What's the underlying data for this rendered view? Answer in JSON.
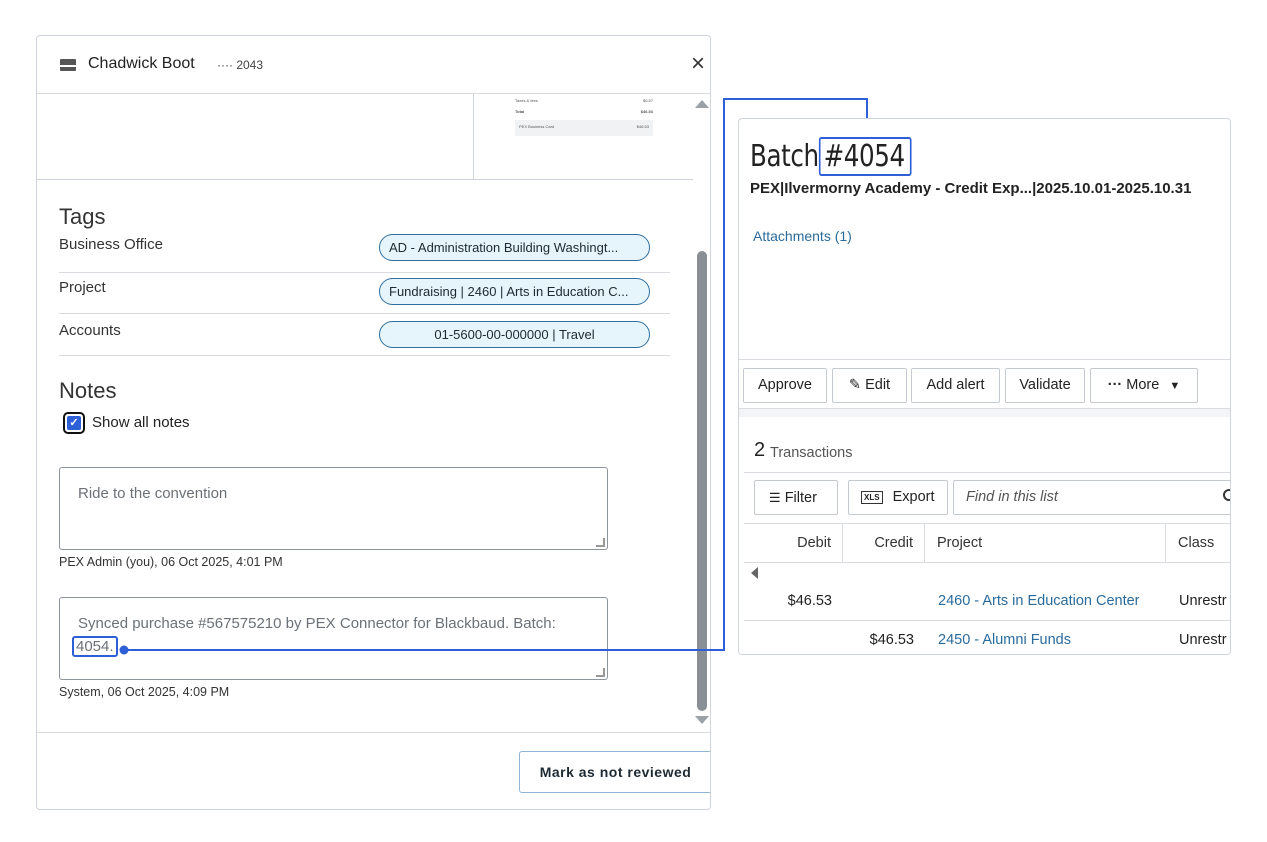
{
  "card": {
    "holder_name": "Chadwick Boot",
    "last4": "···· 2043",
    "close_glyph": "×"
  },
  "receipt_thumb": {
    "lines": [
      {
        "label": "Taxes & fees",
        "value": "$0.57"
      },
      {
        "label": "Total",
        "value": "$46.53"
      }
    ],
    "payment_label": "PEX Business Card",
    "payment_value": "$46.53"
  },
  "tags": {
    "title": "Tags",
    "rows": [
      {
        "label": "Business Office",
        "value": "AD - Administration Building Washingt..."
      },
      {
        "label": "Project",
        "value": "Fundraising | 2460 | Arts in Education C..."
      },
      {
        "label": "Accounts",
        "value": "01-5600-00-000000 | Travel"
      }
    ]
  },
  "notes": {
    "title": "Notes",
    "show_all_label": "Show all notes",
    "show_all_checked": true,
    "items": [
      {
        "text": "Ride to the convention",
        "meta": "PEX Admin (you), 06 Oct 2025, 4:01 PM"
      },
      {
        "text": "Synced purchase #567575210 by PEX Connector for Blackbaud. Batch:",
        "highlight": "4054.",
        "meta": "System, 06 Oct 2025, 4:09 PM"
      }
    ]
  },
  "footer": {
    "mark_button": "Mark as not reviewed"
  },
  "batch": {
    "title_prefix": "Batch",
    "number": "#4054",
    "subtitle": "PEX|Ilvermorny Academy - Credit Exp...|2025.10.01-2025.10.31",
    "attachments": "Attachments (1)",
    "toolbar": {
      "approve": "Approve",
      "edit": "Edit",
      "add_alert": "Add alert",
      "validate": "Validate",
      "more": "More"
    },
    "transactions_count": "2",
    "transactions_label": "Transactions",
    "filter": "Filter",
    "export": "Export",
    "export_icon_text": "XLS",
    "find_placeholder": "Find in this list",
    "columns": [
      "Debit",
      "Credit",
      "Project",
      "Class"
    ],
    "rows": [
      {
        "debit": "$46.53",
        "credit": "",
        "project": "2460 - Arts in Education Center",
        "class": "Unrestr"
      },
      {
        "debit": "",
        "credit": "$46.53",
        "project": "2450 - Alumni Funds",
        "class": "Unrestr"
      }
    ]
  },
  "colors": {
    "accent": "#2d5fd6",
    "link": "#2a6b9c",
    "tag_fill": "#e6f4fb",
    "tag_border": "#2f6f9f"
  }
}
